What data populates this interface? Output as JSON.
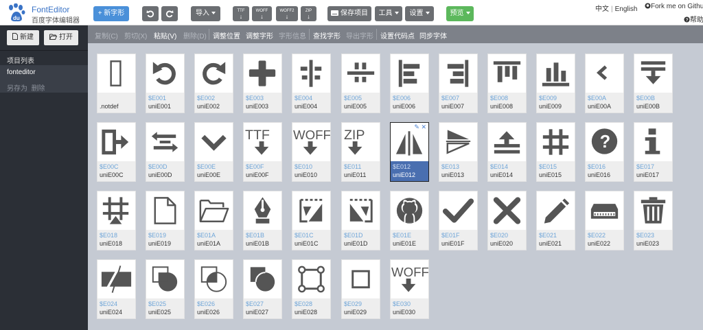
{
  "app": {
    "title": "FontEditor",
    "subtitle": "百度字体编辑器"
  },
  "toolbar": {
    "new_glyph": "+ 新字形",
    "import": "导入",
    "export_ttf": "TTF",
    "export_woff": "WOFF",
    "export_woff2": "WOFF2",
    "export_zip": "ZIP",
    "save": "保存项目",
    "tools": "工具",
    "settings": "设置",
    "preview": "预览"
  },
  "topright": {
    "lang_cn": "中文",
    "lang_en": "English",
    "fork": "Fork me on Github",
    "help": "帮助"
  },
  "sidebar": {
    "new_label": "新建",
    "open_label": "打开",
    "list_title": "项目列表",
    "project_name": "fonteditor",
    "save_as": "另存为",
    "delete": "删除"
  },
  "editbar": {
    "copy": "复制(C)",
    "cut": "剪切(X)",
    "paste": "粘贴(V)",
    "del": "删除(D)",
    "adjust_pos": "调整位置",
    "adjust_glyph": "调整字形",
    "glyph_info": "字形信息",
    "find_glyph": "查找字形",
    "export_glyph": "导出字形",
    "set_codepoint": "设置代码点",
    "sync_font": "同步字体"
  },
  "glyphs": [
    {
      "code": "",
      "name": ".notdef",
      "icon": "notdef-icon"
    },
    {
      "code": "$E001",
      "name": "uniE001",
      "icon": "undo-icon"
    },
    {
      "code": "$E002",
      "name": "uniE002",
      "icon": "redo-icon"
    },
    {
      "code": "$E003",
      "name": "uniE003",
      "icon": "plus-icon"
    },
    {
      "code": "$E004",
      "name": "uniE004",
      "icon": "align-vcenter-icon"
    },
    {
      "code": "$E005",
      "name": "uniE005",
      "icon": "align-hcenter-icon"
    },
    {
      "code": "$E006",
      "name": "uniE006",
      "icon": "align-left-icon"
    },
    {
      "code": "$E007",
      "name": "uniE007",
      "icon": "align-right-icon"
    },
    {
      "code": "$E008",
      "name": "uniE008",
      "icon": "align-top-icon"
    },
    {
      "code": "$E009",
      "name": "uniE009",
      "icon": "align-bottom-icon"
    },
    {
      "code": "$E00A",
      "name": "uniE00A",
      "icon": "chevron-left-icon"
    },
    {
      "code": "$E00B",
      "name": "uniE00B",
      "icon": "download-bar-icon"
    },
    {
      "code": "$E00C",
      "name": "uniE00C",
      "icon": "export-right-icon"
    },
    {
      "code": "$E00D",
      "name": "uniE00D",
      "icon": "swap-icon"
    },
    {
      "code": "$E00E",
      "name": "uniE00E",
      "icon": "chevron-down-icon"
    },
    {
      "code": "$E00F",
      "name": "uniE00F",
      "icon": "ttf-download-icon"
    },
    {
      "code": "$E010",
      "name": "uniE010",
      "icon": "woff-download-icon"
    },
    {
      "code": "$E011",
      "name": "uniE011",
      "icon": "zip-download-icon"
    },
    {
      "code": "$E012",
      "name": "uniE012",
      "icon": "mirror-vertical-icon"
    },
    {
      "code": "$E013",
      "name": "uniE013",
      "icon": "mirror-horizontal-icon"
    },
    {
      "code": "$E014",
      "name": "uniE014",
      "icon": "upload-bar-icon"
    },
    {
      "code": "$E015",
      "name": "uniE015",
      "icon": "grid-hash-icon"
    },
    {
      "code": "$E016",
      "name": "uniE016",
      "icon": "question-circle-icon"
    },
    {
      "code": "$E017",
      "name": "uniE017",
      "icon": "info-icon"
    },
    {
      "code": "$E018",
      "name": "uniE018",
      "icon": "hash-point-icon"
    },
    {
      "code": "$E019",
      "name": "uniE019",
      "icon": "file-icon"
    },
    {
      "code": "$E01A",
      "name": "uniE01A",
      "icon": "folder-open-icon"
    },
    {
      "code": "$E01B",
      "name": "uniE01B",
      "icon": "pen-nib-icon"
    },
    {
      "code": "$E01C",
      "name": "uniE01C",
      "icon": "flip-left-icon"
    },
    {
      "code": "$E01D",
      "name": "uniE01D",
      "icon": "flip-right-icon"
    },
    {
      "code": "$E01E",
      "name": "uniE01E",
      "icon": "github-icon"
    },
    {
      "code": "$E01F",
      "name": "uniE01F",
      "icon": "check-icon"
    },
    {
      "code": "$E020",
      "name": "uniE020",
      "icon": "cross-icon"
    },
    {
      "code": "$E021",
      "name": "uniE021",
      "icon": "pencil-icon"
    },
    {
      "code": "$E022",
      "name": "uniE022",
      "icon": "drive-icon"
    },
    {
      "code": "$E023",
      "name": "uniE023",
      "icon": "trash-icon"
    },
    {
      "code": "$E024",
      "name": "uniE024",
      "icon": "split-shape-icon"
    },
    {
      "code": "$E025",
      "name": "uniE025",
      "icon": "shape-union-icon"
    },
    {
      "code": "$E026",
      "name": "uniE026",
      "icon": "shape-intersect-icon"
    },
    {
      "code": "$E027",
      "name": "uniE027",
      "icon": "shape-subtract-icon"
    },
    {
      "code": "$E028",
      "name": "uniE028",
      "icon": "bezier-square-icon"
    },
    {
      "code": "$E029",
      "name": "uniE029",
      "icon": "square-outline-icon"
    },
    {
      "code": "$E030",
      "name": "uniE030",
      "icon": "woff-download-icon"
    }
  ],
  "selected_glyph": "$E012",
  "colors": {
    "accent": "#4a90d9",
    "selected": "#4a6fb0",
    "sidebar": "#2b2f36",
    "preview": "#5cb85c",
    "icon": "#555555"
  }
}
